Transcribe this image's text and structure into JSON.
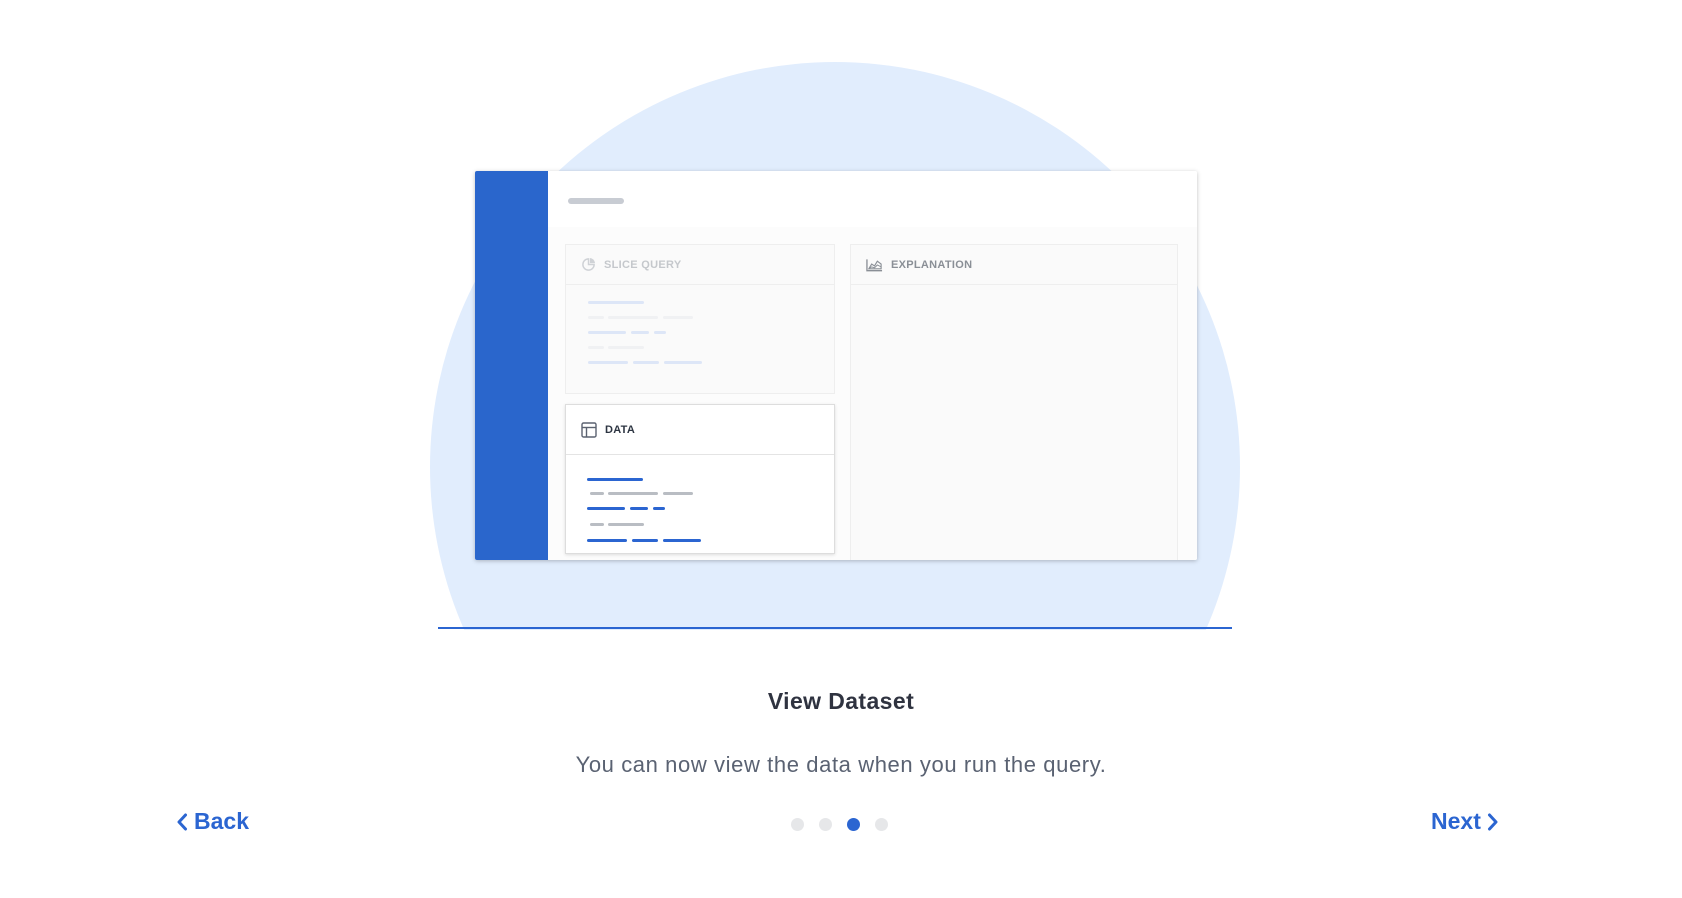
{
  "illustration": {
    "panels": {
      "slice_query": {
        "label": "SLICE QUERY"
      },
      "explanation": {
        "label": "EXPLANATION"
      },
      "data": {
        "label": "DATA"
      }
    }
  },
  "step": {
    "title": "View Dataset",
    "description": "You can now view the data when you run the query."
  },
  "navigation": {
    "back_label": "Back",
    "next_label": "Next",
    "total_steps": 4,
    "current_step": 3
  },
  "colors": {
    "accent": "#2b65d1",
    "circle_bg": "#e1edfd",
    "sidebar": "#2a66cc",
    "dot_inactive": "#e6e7e9",
    "title_text": "#2f3340",
    "body_text": "#5a6272"
  }
}
